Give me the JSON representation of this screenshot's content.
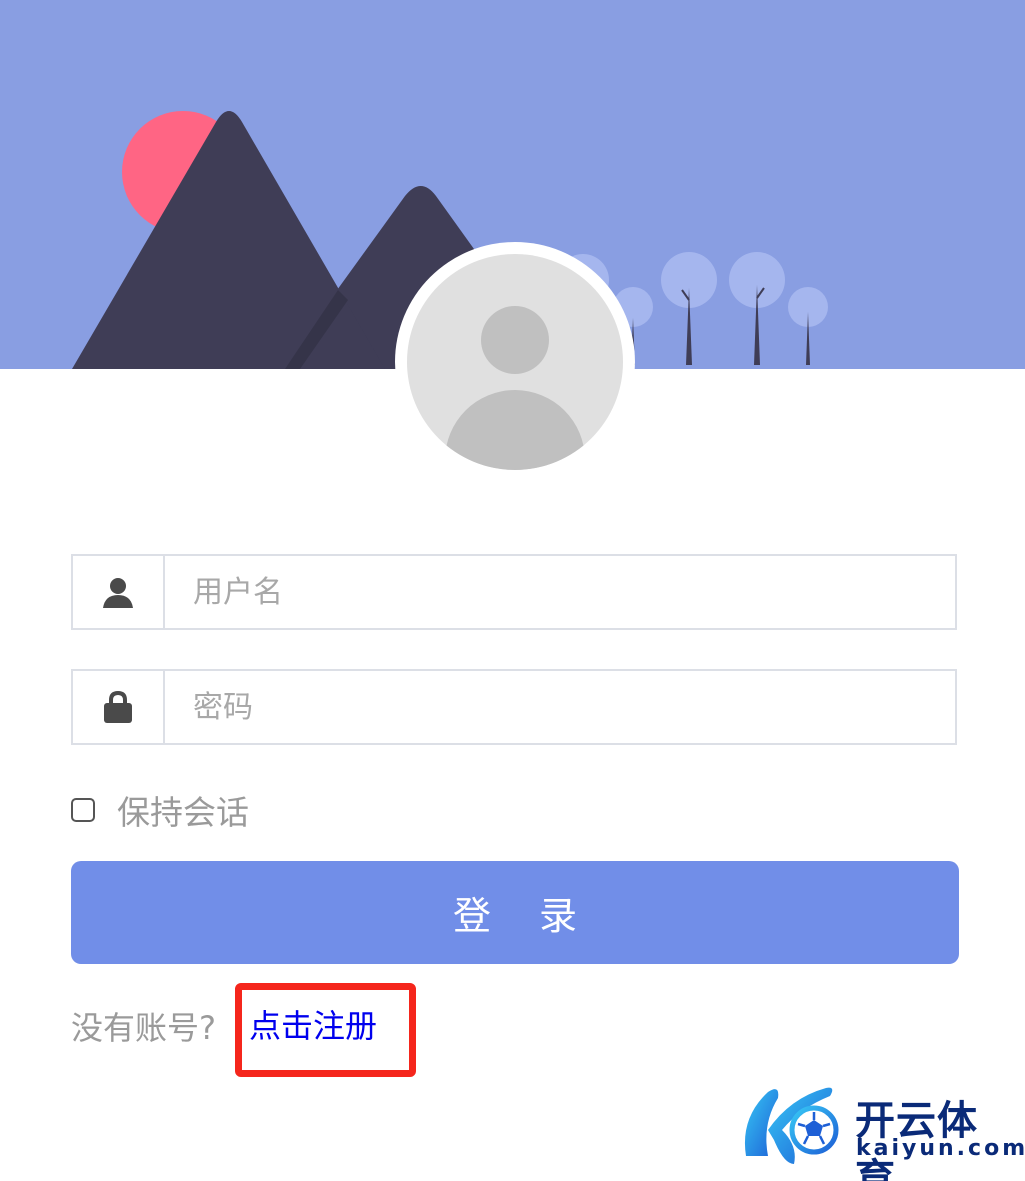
{
  "login_form": {
    "username_placeholder": "用户名",
    "password_placeholder": "密码",
    "keep_session_label": "保持会话",
    "login_button_label": "登 录",
    "no_account_text": "没有账号?",
    "register_link_label": "点击注册"
  },
  "icons": {
    "username": "user-icon",
    "password": "lock-icon",
    "avatar": "default-avatar-icon"
  },
  "watermark": {
    "brand_cn": "开云体育",
    "brand_en": "kaiyun.com"
  },
  "colors": {
    "banner_bg": "#899ee2",
    "primary_button": "#718ee8",
    "link": "#0000ee",
    "highlight_box": "#f5261c",
    "sun": "#ff6584",
    "mountain": "#3f3d56"
  }
}
